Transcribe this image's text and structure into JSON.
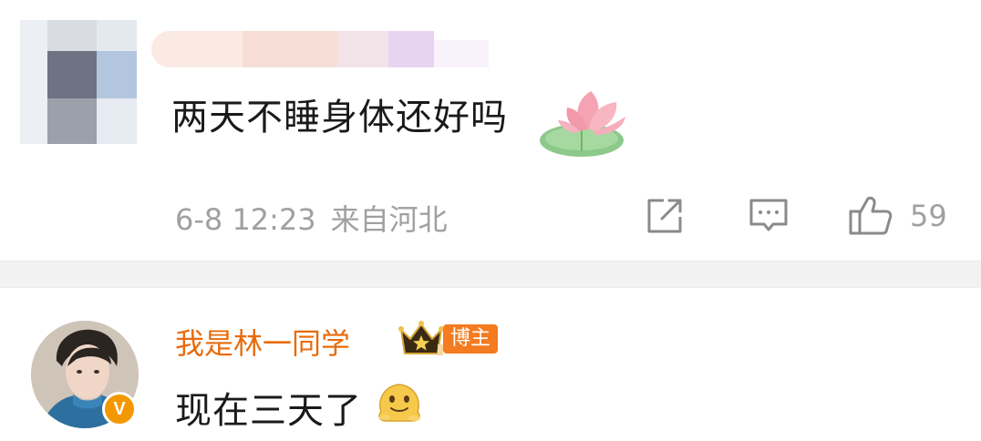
{
  "comments": [
    {
      "author": "",
      "text": "两天不睡身体还好吗",
      "sticker": "lotus-sticker",
      "timestamp": "6-8 12:23",
      "location": "来自河北",
      "actions": {
        "share_icon": "share-icon",
        "reply_icon": "comment-icon",
        "like_icon": "thumbs-up-icon",
        "like_count": "59"
      }
    },
    {
      "author": "我是林一同学",
      "crown_icon": "crown-icon",
      "author_tag": "博主",
      "verified_badge": "V",
      "text": "现在三天了",
      "emoji": "melting-face-emoji"
    }
  ],
  "colors": {
    "author_name": "#e86b0c",
    "tag_bg": "#f47b20",
    "meta_text": "#a0a0a0",
    "body_text": "#1a1a1a",
    "divider": "#f2f2f2",
    "verified_badge": "#f39800"
  }
}
